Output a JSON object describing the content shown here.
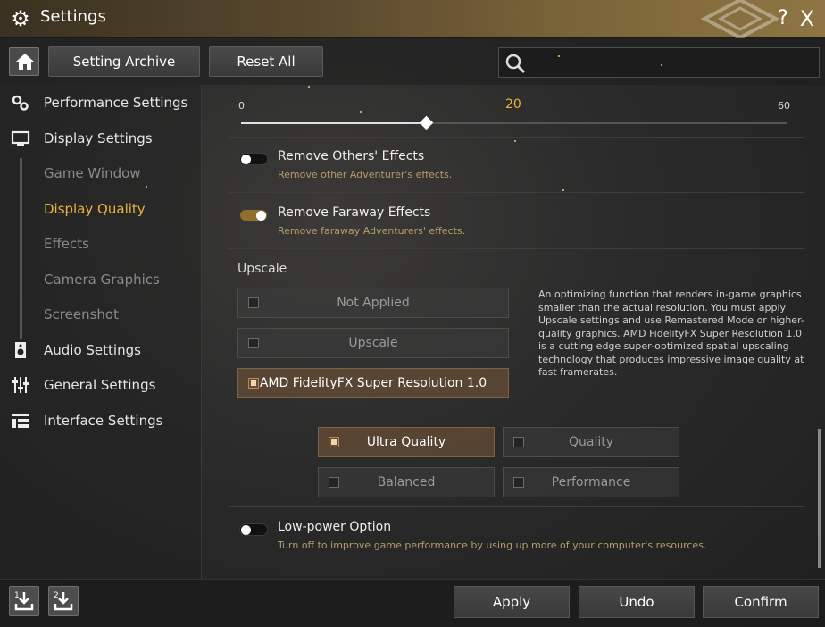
{
  "window": {
    "title": "Settings",
    "help_label": "?",
    "close_label": "X"
  },
  "toolbar": {
    "archive_label": "Setting Archive",
    "reset_label": "Reset All",
    "search_value": "",
    "search_placeholder": ""
  },
  "sidebar": {
    "items": [
      {
        "label": "Performance Settings",
        "icon": "gears-icon"
      },
      {
        "label": "Display Settings",
        "icon": "monitor-icon"
      },
      {
        "label": "Game Window",
        "sub": true
      },
      {
        "label": "Display Quality",
        "sub": true,
        "active": true
      },
      {
        "label": "Effects",
        "sub": true
      },
      {
        "label": "Camera Graphics",
        "sub": true
      },
      {
        "label": "Screenshot",
        "sub": true
      },
      {
        "label": "Audio Settings",
        "icon": "speaker-icon"
      },
      {
        "label": "General Settings",
        "icon": "sliders-icon"
      },
      {
        "label": "Interface Settings",
        "icon": "layout-icon"
      }
    ]
  },
  "slider": {
    "min": "0",
    "max": "60",
    "value": "20",
    "fraction": 0.33
  },
  "options": {
    "remove_others": {
      "title": "Remove Others' Effects",
      "desc": "Remove other Adventurer's effects.",
      "on": false
    },
    "remove_faraway": {
      "title": "Remove Faraway Effects",
      "desc": "Remove faraway Adventurers' effects.",
      "on": true
    },
    "low_power": {
      "title": "Low-power Option",
      "desc": "Turn off to improve game performance by using up more of your computer's resources.",
      "on": false
    }
  },
  "upscale": {
    "title": "Upscale",
    "choices": [
      "Not Applied",
      "Upscale",
      "AMD FidelityFX Super Resolution 1.0"
    ],
    "selected": "AMD FidelityFX Super Resolution 1.0",
    "info": "An optimizing function that renders in-game graphics smaller than the actual resolution. You must apply Upscale settings and use Remastered Mode or higher-quality graphics. AMD FidelityFX Super Resolution 1.0 is a cutting edge super-optimized spatial upscaling technology that produces impressive image quality at fast framerates.",
    "quality": [
      "Ultra Quality",
      "Quality",
      "Balanced",
      "Performance"
    ],
    "quality_selected": "Ultra Quality"
  },
  "bottom": {
    "apply_label": "Apply",
    "undo_label": "Undo",
    "confirm_label": "Confirm",
    "slot1_label": "1",
    "slot2_label": "2"
  },
  "colors": {
    "accent": "#e8b43b",
    "desc": "#b39d6a",
    "selected_bg": "#6e5236"
  }
}
